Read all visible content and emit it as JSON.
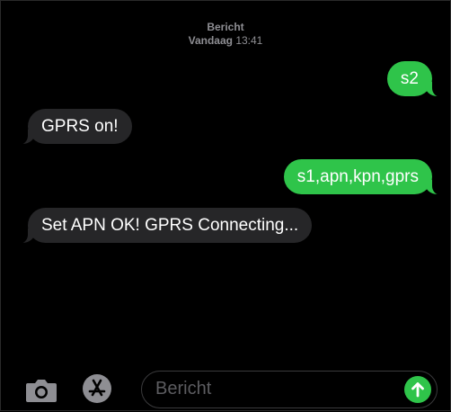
{
  "header": {
    "service": "Bericht",
    "timestamp_day": "Vandaag",
    "timestamp_time": "13:41"
  },
  "messages": [
    {
      "direction": "outgoing",
      "text": "s2"
    },
    {
      "direction": "incoming",
      "text": "GPRS on!"
    },
    {
      "direction": "outgoing",
      "text": "s1,apn,kpn,gprs"
    },
    {
      "direction": "incoming",
      "text": "Set APN OK! GPRS Connecting..."
    }
  ],
  "composer": {
    "placeholder": "Bericht",
    "value": ""
  },
  "icons": {
    "camera": "camera-icon",
    "appstore": "app-store-icon",
    "send": "send-arrow-up-icon"
  },
  "colors": {
    "background": "#000000",
    "outgoing_bubble": "#2fc44a",
    "incoming_bubble": "#262628",
    "timestamp": "#8e8e93",
    "icon_gray": "#8e8e93"
  }
}
